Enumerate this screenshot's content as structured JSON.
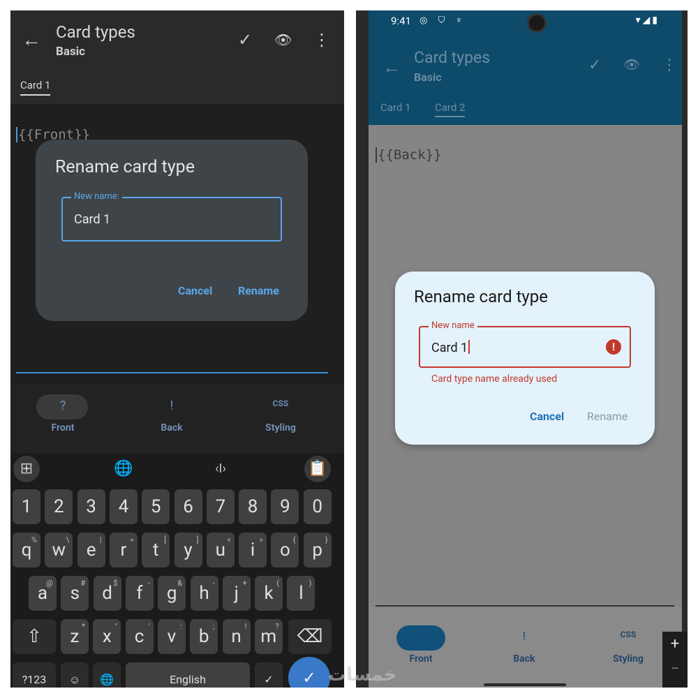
{
  "left": {
    "app_title": "Card types",
    "app_subtitle": "Basic",
    "actions": {
      "back_icon": "←",
      "check_icon": "✓",
      "eye_icon": "👁",
      "more_icon": "⋮"
    },
    "tabs": [
      {
        "label": "Card 1"
      }
    ],
    "editor_text": "{{Front}}",
    "dialog": {
      "title": "Rename card type",
      "field_label": "New name:",
      "field_value": "Card 1",
      "cancel": "Cancel",
      "rename": "Rename"
    },
    "bottom_nav": [
      {
        "label": "Front",
        "icon": "?"
      },
      {
        "label": "Back",
        "icon": "!"
      },
      {
        "label": "Styling",
        "icon": "CSS"
      }
    ],
    "keyboard": {
      "toolbar": [
        "⊞",
        "🌐",
        "‹I›",
        "📋"
      ],
      "digits": [
        "1",
        "2",
        "3",
        "4",
        "5",
        "6",
        "7",
        "8",
        "9",
        "0"
      ],
      "row1": [
        [
          "q",
          "%"
        ],
        [
          "w",
          "\\"
        ],
        [
          "e",
          "|"
        ],
        [
          "r",
          "="
        ],
        [
          "t",
          "["
        ],
        [
          "y",
          "]"
        ],
        [
          "u",
          "<"
        ],
        [
          "i",
          ">"
        ],
        [
          "o",
          "{"
        ],
        [
          "p",
          "}"
        ]
      ],
      "row2": [
        [
          "a",
          "@"
        ],
        [
          "s",
          "#"
        ],
        [
          "d",
          "$"
        ],
        [
          "f",
          "-"
        ],
        [
          "g",
          "&"
        ],
        [
          "h",
          "-"
        ],
        [
          "j",
          "+"
        ],
        [
          "k",
          "("
        ],
        [
          "l",
          ")"
        ]
      ],
      "row3": [
        [
          "z",
          "*"
        ],
        [
          "x",
          "\""
        ],
        [
          "c",
          "'"
        ],
        [
          "v",
          ":"
        ],
        [
          "b",
          ";"
        ],
        [
          "n",
          "!"
        ],
        [
          "m",
          "?"
        ]
      ],
      "shift": "⇧",
      "backspace": "⌫",
      "sym": "?123",
      "emoji": "☺",
      "globe": "🌐",
      "space": "English",
      "enter": "✓"
    }
  },
  "right": {
    "status": {
      "time": "9:41",
      "left_icons": "◎ ⛉ ♆",
      "right_icons": "▾◢▮"
    },
    "app_title": "Card types",
    "app_subtitle": "Basic",
    "actions": {
      "back_icon": "←",
      "check_icon": "✓",
      "eye_icon": "👁",
      "more_icon": "⋮"
    },
    "tabs": [
      {
        "label": "Card 1"
      },
      {
        "label": "Card 2"
      }
    ],
    "editor_text": "{{Back}}",
    "dialog": {
      "title": "Rename card type",
      "field_label": "New name",
      "field_value": "Card 1",
      "error_icon": "!",
      "error_text": "Card type name already used",
      "cancel": "Cancel",
      "rename": "Rename"
    },
    "bottom_nav": [
      {
        "label": "Front",
        "icon": "?"
      },
      {
        "label": "Back",
        "icon": "!"
      },
      {
        "label": "Styling",
        "icon": "CSS"
      }
    ],
    "zoom": {
      "plus": "+",
      "minus": "−"
    }
  },
  "watermark": "خمسات"
}
